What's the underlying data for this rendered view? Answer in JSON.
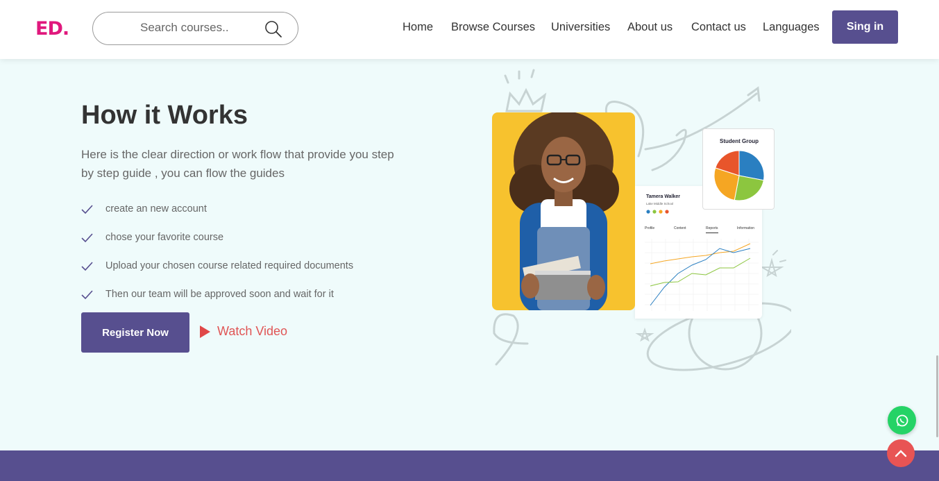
{
  "header": {
    "logo_text": "ED",
    "logo_dot": ".",
    "search_placeholder": "Search courses..",
    "nav": [
      {
        "label": "Home"
      },
      {
        "label": "Browse Courses"
      },
      {
        "label": "Universities"
      },
      {
        "label": "About us"
      },
      {
        "label": "Contact us"
      },
      {
        "label": "Languages"
      }
    ],
    "signin_label": "Sing in"
  },
  "main": {
    "title": "How it Works",
    "description": "Here is the clear direction or work flow that provide you step by step guide , you can flow the guides",
    "steps": [
      "create an new account",
      "chose your favorite course",
      "Upload your chosen course related required documents",
      "Then our team will be approved soon and wait for it"
    ],
    "register_label": "Register Now",
    "watch_label": "Watch Video"
  },
  "illustration": {
    "dashboard": {
      "name": "Tamera Walker",
      "school": "Lake Middle School",
      "tabs": [
        "Profile",
        "Content",
        "Reports",
        "Information"
      ]
    },
    "pie_card": {
      "title": "Student Group",
      "slices": [
        {
          "value": 28,
          "color": "#2a7fc1"
        },
        {
          "value": 25,
          "color": "#8cc63f"
        },
        {
          "value": 27,
          "color": "#f5a623"
        },
        {
          "value": 20,
          "color": "#e8552b"
        }
      ]
    }
  },
  "colors": {
    "brand": "#574f8f",
    "logo": "#e0197d",
    "accent_red": "#e05555",
    "page_bg": "#effbfb"
  },
  "icons": {
    "search": "search-icon",
    "check": "check-icon",
    "play": "play-icon",
    "whatsapp": "whatsapp-icon",
    "scroll_top": "chevron-up-icon"
  }
}
